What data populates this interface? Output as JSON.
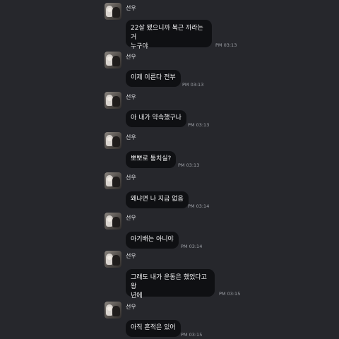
{
  "messages": [
    {
      "sender": "선우",
      "text": "22살 됐으니까 복근 까라는 거\n누구야",
      "time": "PM 03:13"
    },
    {
      "sender": "선우",
      "text": "이제 이른다 전부",
      "time": "PM 03:13"
    },
    {
      "sender": "선우",
      "text": "아 내가 약속했구나",
      "time": "PM 03:13"
    },
    {
      "sender": "선우",
      "text": "뽀뽀로 퉁치실?",
      "time": "PM 03:13"
    },
    {
      "sender": "선우",
      "text": "왜냐면 나 지금 없음",
      "time": "PM 03:14"
    },
    {
      "sender": "선우",
      "text": "아기배는 아니야",
      "time": "PM 03:14"
    },
    {
      "sender": "선우",
      "text": "그래도 내가 운동은 했었다고 왕\n년에",
      "time": "PM 03:15"
    },
    {
      "sender": "선우",
      "text": "아직 흔적은 있어",
      "time": "PM 03:15"
    }
  ]
}
